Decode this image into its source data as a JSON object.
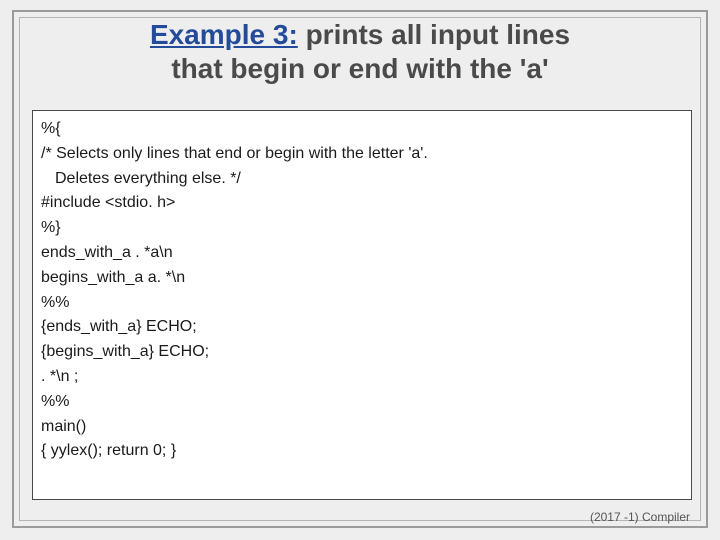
{
  "title": {
    "lead": "Example 3:",
    "rest_line1": " prints all input lines",
    "line2": "that begin or end with the 'a'"
  },
  "code": {
    "l01": "%{",
    "l02": "/* Selects only lines that end or begin with the letter 'a'.",
    "l03": "Deletes everything else. */",
    "l04": "#include <stdio. h>",
    "l05": "%}",
    "l06": "ends_with_a . *a\\n",
    "l07": "begins_with_a a. *\\n",
    "l08": "%%",
    "l09": "{ends_with_a} ECHO;",
    "l10": "{begins_with_a} ECHO;",
    "l11": ". *\\n ;",
    "l12": "%%",
    "l13": "main()",
    "l14": "{ yylex(); return 0; }"
  },
  "footer": "(2017 -1) Compiler"
}
